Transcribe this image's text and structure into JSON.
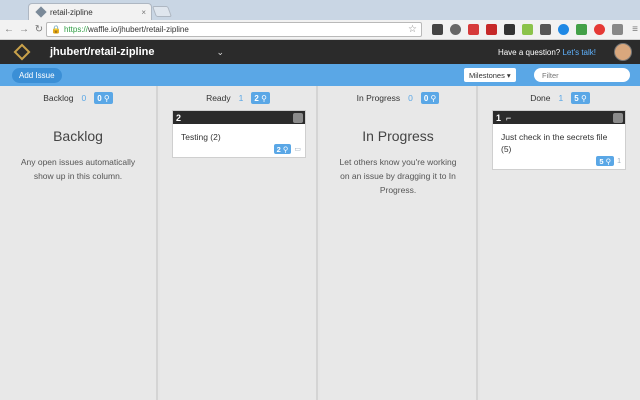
{
  "browser": {
    "tab_title": "retail-zipline",
    "tab_close": "×",
    "nav": {
      "back": "←",
      "forward": "→",
      "reload": "↻"
    },
    "url_protocol": "https://",
    "url_rest": "waffle.io/jhubert/retail-zipline"
  },
  "header": {
    "repo": "jhubert/retail-zipline",
    "chevron": "⌄",
    "question": "Have a question?",
    "talk_link": "Let's talk!"
  },
  "actions": {
    "add_issue": "Add Issue",
    "milestones": "Milestones ▾",
    "filter_placeholder": "Filter"
  },
  "columns": [
    {
      "name": "Backlog",
      "count": "0",
      "badge": "0",
      "empty_title": "Backlog",
      "empty_text": "Any open issues automatically show up in this column."
    },
    {
      "name": "Ready",
      "count": "1",
      "badge": "2",
      "card": {
        "number": "2",
        "title": "Testing (2)",
        "badge": "2"
      }
    },
    {
      "name": "In Progress",
      "count": "0",
      "badge": "0",
      "empty_title": "In Progress",
      "empty_text": "Let others know you're working on an issue by dragging it to In Progress."
    },
    {
      "name": "Done",
      "count": "1",
      "badge": "5",
      "card": {
        "number": "1",
        "title": "Just check in the secrets file (5)",
        "badge": "5",
        "comments": "1"
      }
    }
  ]
}
